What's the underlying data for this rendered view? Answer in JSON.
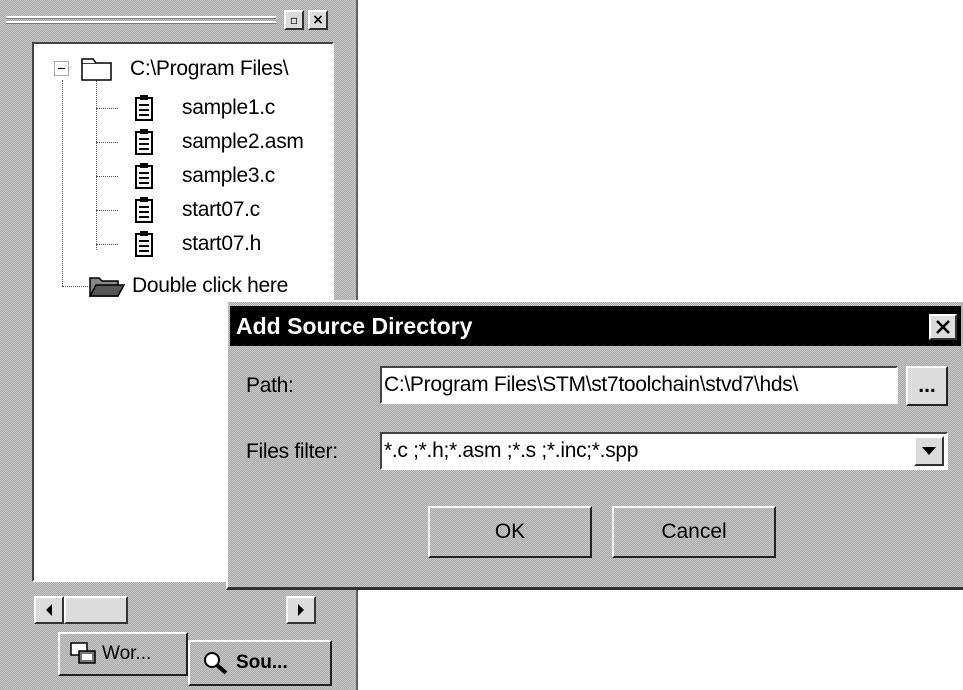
{
  "workspace": {
    "toolbar": {
      "maximize_glyph": "▫",
      "close_glyph": "×"
    },
    "tree": {
      "root_label": "C:\\Program Files\\",
      "files": [
        {
          "label": "sample1.c",
          "icon": "document-icon"
        },
        {
          "label": "sample2.asm",
          "icon": "document-icon"
        },
        {
          "label": "sample3.c",
          "icon": "document-icon"
        },
        {
          "label": "start07.c",
          "icon": "document-icon"
        },
        {
          "label": "start07.h",
          "icon": "document-icon"
        }
      ],
      "add_folder_label": "Double click here"
    },
    "tabs": [
      {
        "label": "Wor...",
        "icon": "workspace-icon"
      },
      {
        "label": "Sou...",
        "icon": "source-browser-icon"
      }
    ]
  },
  "dialog": {
    "title": "Add Source Directory",
    "path_label": "Path:",
    "path_value": "C:\\Program Files\\STM\\st7toolchain\\stvd7\\hds\\",
    "browse_label": "...",
    "filter_label": "Files filter:",
    "filter_value": "*.c ;*.h;*.asm ;*.s ;*.inc;*.spp",
    "ok_label": "OK",
    "cancel_label": "Cancel"
  },
  "colors": {
    "titlebar": "#000000",
    "face": "#c8c8c8",
    "field": "#ffffff"
  }
}
